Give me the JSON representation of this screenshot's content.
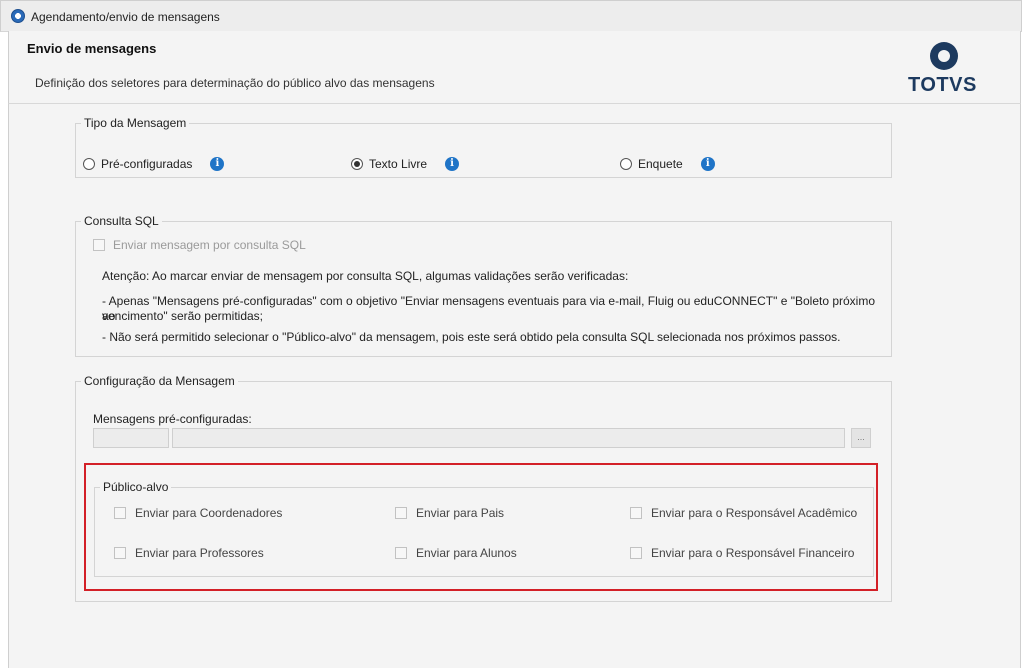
{
  "window": {
    "title": "Agendamento/envio de mensagens"
  },
  "header": {
    "title": "Envio de mensagens",
    "subtitle": "Definição dos seletores para determinação do público alvo das mensagens",
    "logo_text": "TOTVS"
  },
  "tipo_mensagem": {
    "legend": "Tipo da Mensagem",
    "options": [
      {
        "label": "Pré-configuradas",
        "selected": false
      },
      {
        "label": "Texto Livre",
        "selected": true
      },
      {
        "label": "Enquete",
        "selected": false
      }
    ],
    "info_glyph": "i"
  },
  "consulta_sql": {
    "legend": "Consulta SQL",
    "checkbox_label": "Enviar mensagem por consulta SQL",
    "attention": "Atenção: Ao marcar enviar de mensagem por consulta SQL, algumas validações serão verificadas:",
    "rule1_line1": "- Apenas \"Mensagens pré-configuradas\" com o objetivo \"Enviar mensagens eventuais para via e-mail, Fluig ou eduCONNECT\" e \"Boleto próximo ao",
    "rule1_line2": "vencimento\" serão permitidas;",
    "rule2": "- Não será permitido selecionar o \"Público-alvo\" da mensagem, pois este será obtido pela consulta SQL selecionada nos próximos passos."
  },
  "config_mensagem": {
    "legend": "Configuração da Mensagem",
    "field_label": "Mensagens pré-configuradas:",
    "code_value": "",
    "description_value": "",
    "lookup_label": "..."
  },
  "publico_alvo": {
    "legend": "Público-alvo",
    "coordenadores": "Enviar para Coordenadores",
    "pais": "Enviar para Pais",
    "resp_academico": "Enviar para o Responsável Acadêmico",
    "professores": "Enviar para Professores",
    "alunos": "Enviar para Alunos",
    "resp_financeiro": "Enviar para o Responsável Financeiro"
  },
  "colors": {
    "highlight": "#d32027",
    "info": "#1f74c7",
    "brand": "#1d3a5f"
  }
}
